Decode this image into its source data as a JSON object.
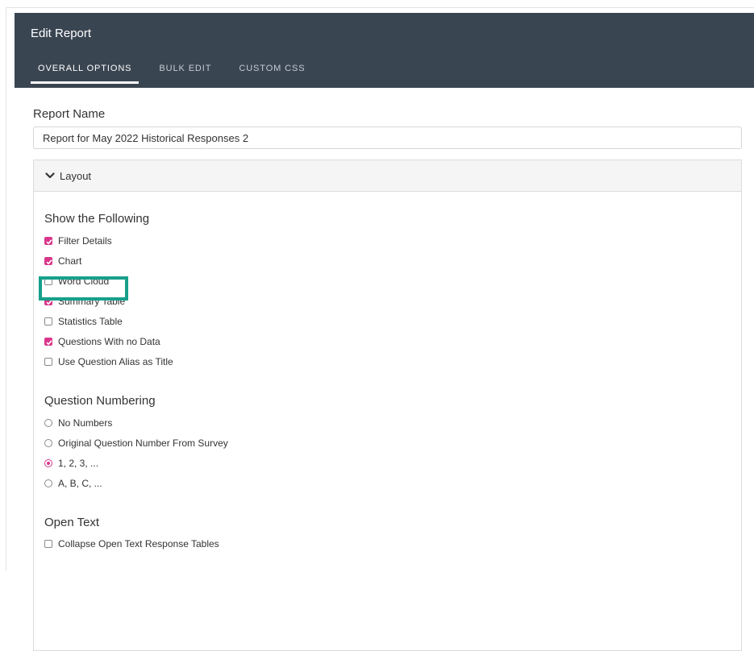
{
  "header": {
    "title": "Edit Report",
    "tabs": [
      {
        "label": "OVERALL OPTIONS",
        "active": true
      },
      {
        "label": "BULK EDIT",
        "active": false
      },
      {
        "label": "CUSTOM CSS",
        "active": false
      }
    ]
  },
  "report_name": {
    "label": "Report Name",
    "value": "Report for May 2022 Historical Responses 2"
  },
  "layout": {
    "label": "Layout",
    "show_following": {
      "title": "Show the Following",
      "options": [
        {
          "label": "Filter Details",
          "checked": true
        },
        {
          "label": "Chart",
          "checked": true
        },
        {
          "label": "Word Cloud",
          "checked": false
        },
        {
          "label": "Summary Table",
          "checked": true
        },
        {
          "label": "Statistics Table",
          "checked": false
        },
        {
          "label": "Questions With no Data",
          "checked": true
        },
        {
          "label": "Use Question Alias as Title",
          "checked": false
        }
      ]
    },
    "question_numbering": {
      "title": "Question Numbering",
      "options": [
        {
          "label": "No Numbers",
          "selected": false
        },
        {
          "label": "Original Question Number From Survey",
          "selected": false
        },
        {
          "label": "1, 2, 3, ...",
          "selected": true
        },
        {
          "label": "A, B, C, ...",
          "selected": false
        }
      ]
    },
    "open_text": {
      "title": "Open Text",
      "options": [
        {
          "label": "Collapse Open Text Response Tables",
          "checked": false
        }
      ]
    }
  },
  "colors": {
    "header_bg": "#3a4552",
    "accent": "#d9368b",
    "highlight": "#17a08b"
  }
}
